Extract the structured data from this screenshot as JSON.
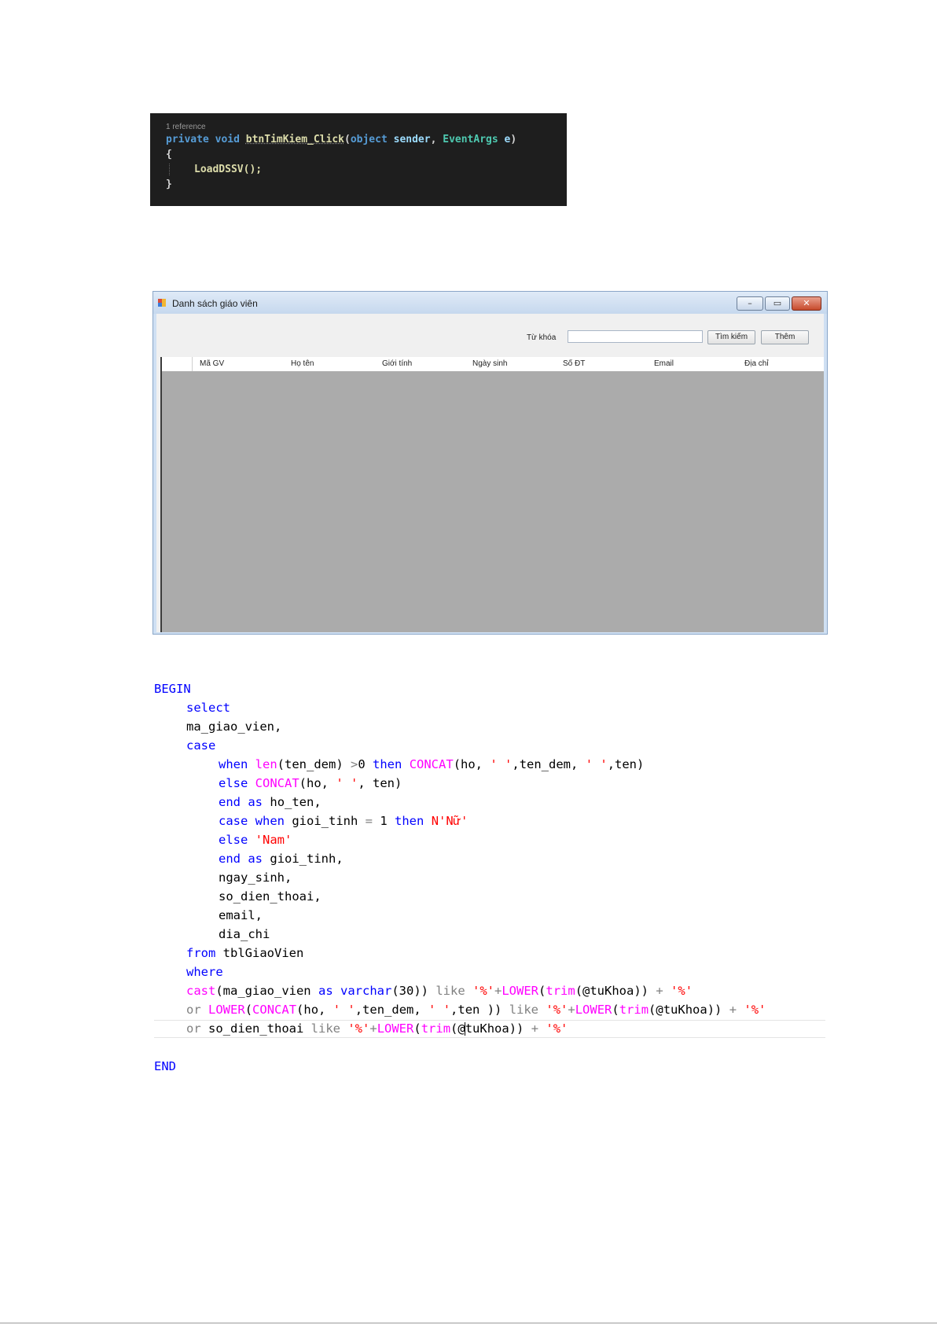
{
  "csharp_code": {
    "codelens": "1 reference",
    "line1": {
      "private": "private",
      "void": "void",
      "method": "btnTimKiem_Click",
      "open_paren": "(",
      "object": "object",
      "sender": "sender",
      "comma": ",",
      "eventargs": "EventArgs",
      "e": "e",
      "close_paren": ")"
    },
    "line2": "{",
    "line3": "LoadDSSV();",
    "line4": "}"
  },
  "window": {
    "title": "Danh sách giáo viên",
    "minimize_glyph": "–",
    "maximize_glyph": "▭",
    "close_glyph": "✕",
    "keyword_label": "Từ khóa",
    "keyword_value": "",
    "search_button": "Tìm kiếm",
    "add_button": "Thêm",
    "columns": [
      "Mã GV",
      "Họ tên",
      "Giới tính",
      "Ngày sinh",
      "Số ĐT",
      "Email",
      "Địa chỉ"
    ]
  },
  "sql": {
    "begin": "BEGIN",
    "select": "select",
    "ma_giao_vien": "ma_giao_vien,",
    "case": "case",
    "when1": {
      "when": "when",
      "len": "len",
      "p1": "(ten_dem) ",
      "gt": ">",
      "zero": "0 ",
      "then": "then",
      "concat": "CONCAT",
      "args_a": "(ho, ",
      "str1": "' '",
      "args_b": ",ten_dem, ",
      "str2": "' '",
      "args_c": ",ten)"
    },
    "else1": {
      "else": "else",
      "concat": "CONCAT",
      "args_a": "(ho, ",
      "str": "' '",
      "args_b": ", ten)"
    },
    "end1": {
      "end": "end",
      "as": "as",
      "name": "ho_ten,"
    },
    "case2": {
      "case": "case",
      "when": "when",
      "col": "gioi_tinh ",
      "eq": "=",
      "one": " 1 ",
      "then": "then",
      "str": "N'Nữ'"
    },
    "else2": {
      "else": "else",
      "str": "'Nam'"
    },
    "end2": {
      "end": "end",
      "as": "as",
      "name": "gioi_tinh,"
    },
    "ngay_sinh": "ngay_sinh,",
    "so_dien_thoai": "so_dien_thoai,",
    "email": "email,",
    "dia_chi": "dia_chi",
    "from": {
      "from": "from",
      "table": "tblGiaoVien"
    },
    "where": "where",
    "cond1": {
      "cast": "cast",
      "a": "(ma_giao_vien ",
      "as": "as",
      "varchar": "varchar",
      "b": "(30)) ",
      "like": "like",
      "pct": "'%'",
      "plus": "+",
      "lower": "LOWER",
      "c": "(",
      "trim": "trim",
      "d": "(@tuKhoa)) ",
      "plus2": "+",
      "pct2": "'%'"
    },
    "cond2": {
      "or": "or",
      "lower": "LOWER",
      "a": "(",
      "concat": "CONCAT",
      "b": "(ho, ",
      "s1": "' '",
      "c": ",ten_dem, ",
      "s2": "' '",
      "d": ",ten )) ",
      "like": "like",
      "pct": "'%'",
      "plus": "+",
      "lower2": "LOWER",
      "e": "(",
      "trim": "trim",
      "f": "(@tuKhoa)) ",
      "plus2": "+",
      "pct2": "'%'"
    },
    "cond3": {
      "or": "or",
      "col": "so_dien_thoai ",
      "like": "like",
      "pct": "'%'",
      "plus": "+",
      "lower": "LOWER",
      "a": "(",
      "trim": "trim",
      "b": "(@",
      "c": "tuKhoa)) ",
      "plus2": "+",
      "pct2": "'%'"
    },
    "end": "END"
  }
}
